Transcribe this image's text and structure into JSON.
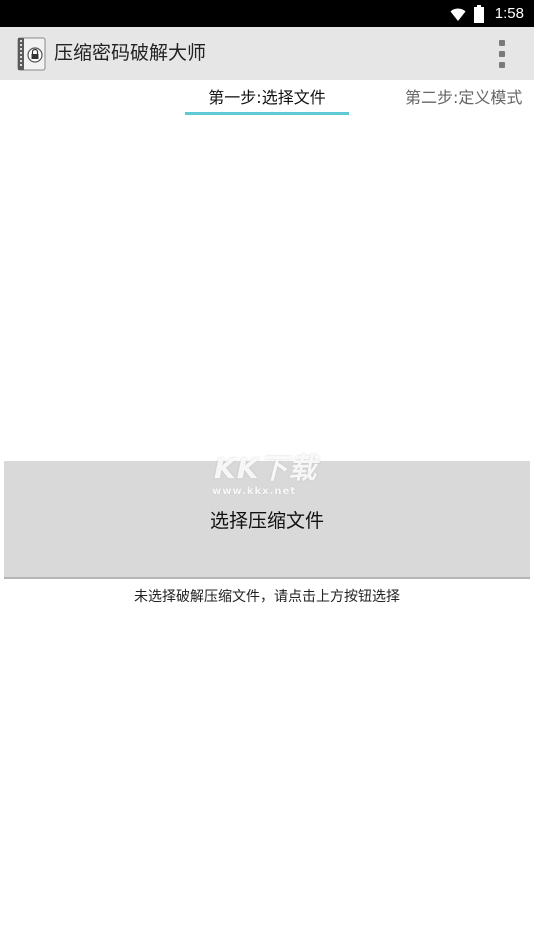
{
  "status_bar": {
    "time": "1:58",
    "wifi_icon": "wifi-icon",
    "battery_icon": "battery-icon"
  },
  "app_bar": {
    "app_icon": "zip-lock-app-icon",
    "title": "压缩密码破解大师",
    "menu_icon": "overflow-menu-icon"
  },
  "tabs": [
    {
      "label": "第一步:选择文件",
      "selected": true
    },
    {
      "label": "第二步:定义模式",
      "selected": false
    }
  ],
  "main": {
    "select_button_label": "选择压缩文件",
    "status_message": "未选择破解压缩文件，请点击上方按钮选择"
  },
  "watermark": {
    "text": "KK下载",
    "url": "www.kkx.net"
  },
  "colors": {
    "status_bar": "#000000",
    "app_bar": "#e6e6e6",
    "tab_indicator": "#5fc9d6",
    "button_bg": "#d9d9d9"
  }
}
